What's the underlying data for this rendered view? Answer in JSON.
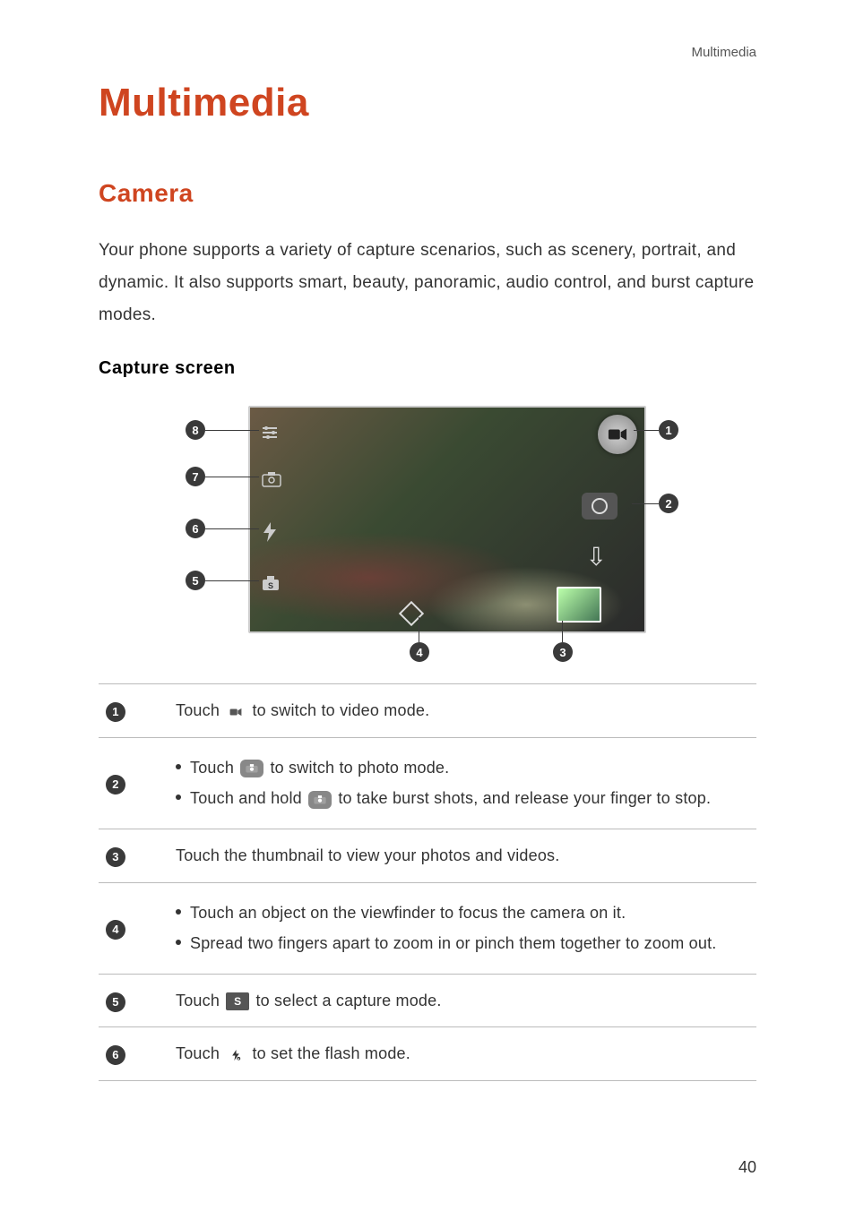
{
  "header": {
    "category": "Multimedia"
  },
  "title": "Multimedia",
  "section": "Camera",
  "intro": "Your phone supports a variety of capture scenarios, such as scenery, portrait, and dynamic. It also supports smart, beauty, panoramic, audio control, and burst capture modes.",
  "subhead": "Capture  screen",
  "callouts": {
    "n1": "1",
    "n2": "2",
    "n3": "3",
    "n4": "4",
    "n5": "5",
    "n6": "6",
    "n7": "7",
    "n8": "8"
  },
  "table": {
    "row1": {
      "touch_prefix": "Touch ",
      "touch_suffix": " to switch to video mode."
    },
    "row2": {
      "b1_prefix": "Touch ",
      "b1_suffix": " to switch to photo mode.",
      "b2_prefix": "Touch and hold ",
      "b2_suffix": " to take burst shots, and release your finger to stop."
    },
    "row3": {
      "text": "Touch the thumbnail to view your photos and videos."
    },
    "row4": {
      "b1": "Touch an object on the viewfinder to focus the camera on it.",
      "b2": "Spread two fingers apart to zoom in or pinch them together to zoom out."
    },
    "row5": {
      "touch_prefix": "Touch ",
      "mode_letter": "S",
      "touch_suffix": " to select a capture mode."
    },
    "row6": {
      "touch_prefix": "Touch ",
      "touch_suffix": " to set the flash mode."
    }
  },
  "page_number": "40"
}
